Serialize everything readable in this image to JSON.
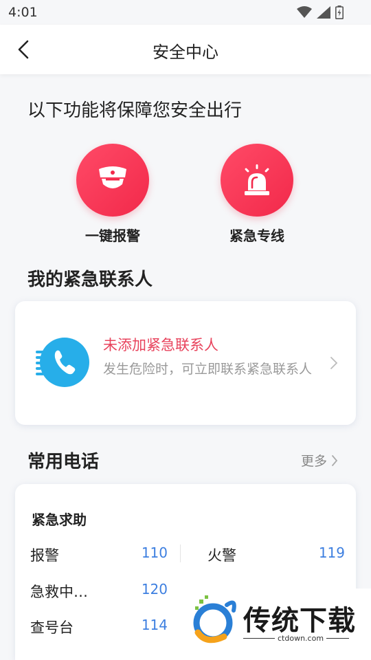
{
  "status_bar": {
    "time": "4:01"
  },
  "header": {
    "title": "安全中心"
  },
  "features_section": {
    "heading": "以下功能将保障您安全出行",
    "items": [
      {
        "label": "一键报警",
        "icon": "police-icon"
      },
      {
        "label": "紧急专线",
        "icon": "siren-icon"
      }
    ]
  },
  "contacts_section": {
    "heading": "我的紧急联系人",
    "card": {
      "title": "未添加紧急联系人",
      "description": "发生危险时，可立即联系紧急联系人"
    }
  },
  "phones_section": {
    "heading": "常用电话",
    "more_label": "更多",
    "group_title": "紧急求助",
    "entries": [
      {
        "label": "报警",
        "number": "110"
      },
      {
        "label": "火警",
        "number": "119"
      },
      {
        "label": "急救中…",
        "number": "120"
      },
      {
        "label": "查号台",
        "number": "114"
      }
    ]
  },
  "watermark": {
    "brand": "传统下载",
    "site": "ctdown.com"
  },
  "colors": {
    "accent_red": "#f2294a",
    "link_blue": "#3d7fe0",
    "phone_icon_blue": "#27aee9"
  }
}
